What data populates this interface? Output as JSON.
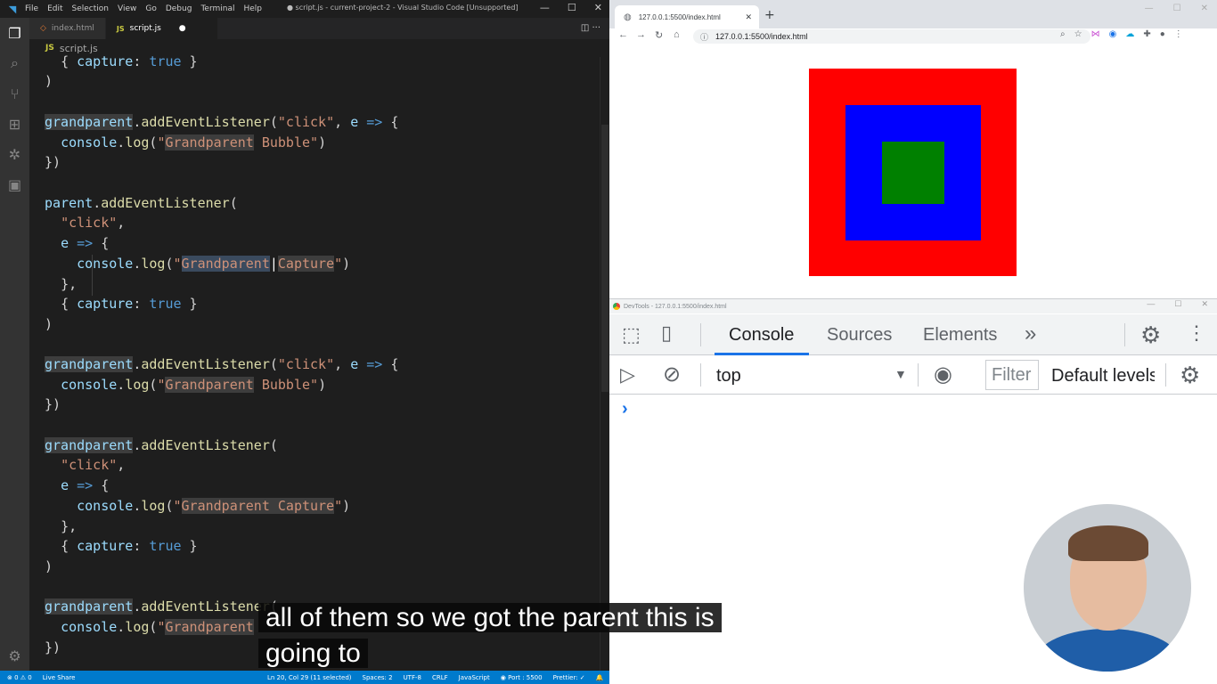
{
  "vscode": {
    "menu": [
      "File",
      "Edit",
      "Selection",
      "View",
      "Go",
      "Debug",
      "Terminal",
      "Help"
    ],
    "window_title": "● script.js - current-project-2 - Visual Studio Code [Unsupported]",
    "tabs": [
      {
        "label": "index.html",
        "icon": "html-file-icon"
      },
      {
        "label": "script.js",
        "icon": "js-file-icon",
        "modified": true
      }
    ],
    "breadcrumb": {
      "badge": "JS",
      "file": "script.js"
    },
    "status": {
      "errors": "0",
      "warnings": "0",
      "live_share": "Live Share",
      "position": "Ln 20, Col 29 (11 selected)",
      "spaces": "Spaces: 2",
      "encoding": "UTF-8",
      "eol": "CRLF",
      "language": "JavaScript",
      "port": "Port : 5500",
      "prettier": "Prettier: ✓"
    },
    "accent": "#007acc"
  },
  "subtitle": {
    "line1": "all of them so we got the parent this is",
    "line2": "going to"
  },
  "browser": {
    "tab_title": "127.0.0.1:5500/index.html",
    "url": "127.0.0.1:5500/index.html",
    "box_colors": {
      "grandparent": "#ff0000",
      "parent": "#0000ff",
      "child": "#008000"
    }
  },
  "devtools": {
    "title": "DevTools - 127.0.0.1:5500/index.html",
    "tabs": [
      "Console",
      "Sources",
      "Elements"
    ],
    "more": "»",
    "context": "top",
    "filter_placeholder": "Filter",
    "levels": "Default levels",
    "prompt": "›"
  }
}
